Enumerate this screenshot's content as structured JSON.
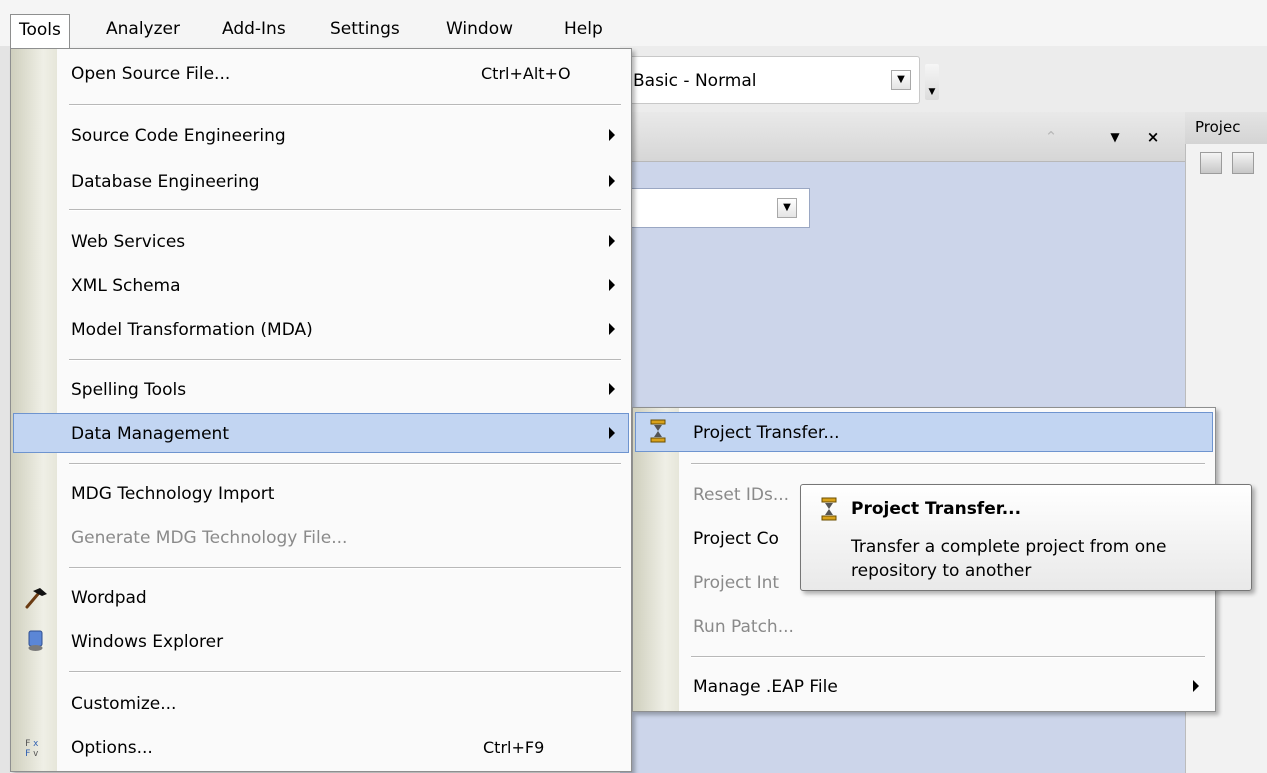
{
  "menubar": {
    "items": [
      {
        "label": "Tools"
      },
      {
        "label": "Analyzer"
      },
      {
        "label": "Add-Ins"
      },
      {
        "label": "Settings"
      },
      {
        "label": "Window"
      },
      {
        "label": "Help"
      }
    ]
  },
  "toolbar": {
    "perspective_value": "Basic - Normal"
  },
  "right_panel": {
    "title": "Projec"
  },
  "tools_menu": {
    "items": [
      {
        "label": "Open Source File...",
        "shortcut": "Ctrl+Alt+O"
      },
      {
        "label": "Source Code Engineering"
      },
      {
        "label": "Database Engineering"
      },
      {
        "label": "Web Services"
      },
      {
        "label": "XML Schema"
      },
      {
        "label": "Model Transformation (MDA)"
      },
      {
        "label": "Spelling Tools"
      },
      {
        "label": "Data Management"
      },
      {
        "label": "MDG Technology Import"
      },
      {
        "label": "Generate MDG Technology File..."
      },
      {
        "label": "Wordpad"
      },
      {
        "label": "Windows Explorer"
      },
      {
        "label": "Customize..."
      },
      {
        "label": "Options...",
        "shortcut": "Ctrl+F9"
      }
    ]
  },
  "data_menu": {
    "items": [
      {
        "label": "Project Transfer..."
      },
      {
        "label": "Reset IDs..."
      },
      {
        "label": "Project Co"
      },
      {
        "label": "Project Int"
      },
      {
        "label": "Run Patch..."
      },
      {
        "label": "Manage .EAP File"
      }
    ]
  },
  "tooltip": {
    "title": "Project Transfer...",
    "body": "Transfer a complete project from one repository to another"
  },
  "colors": {
    "highlight": "#c2d5f2",
    "highlight_border": "#6e94cf",
    "panel_body": "#ccd5ea",
    "disabled_text": "#8a8a8a"
  }
}
